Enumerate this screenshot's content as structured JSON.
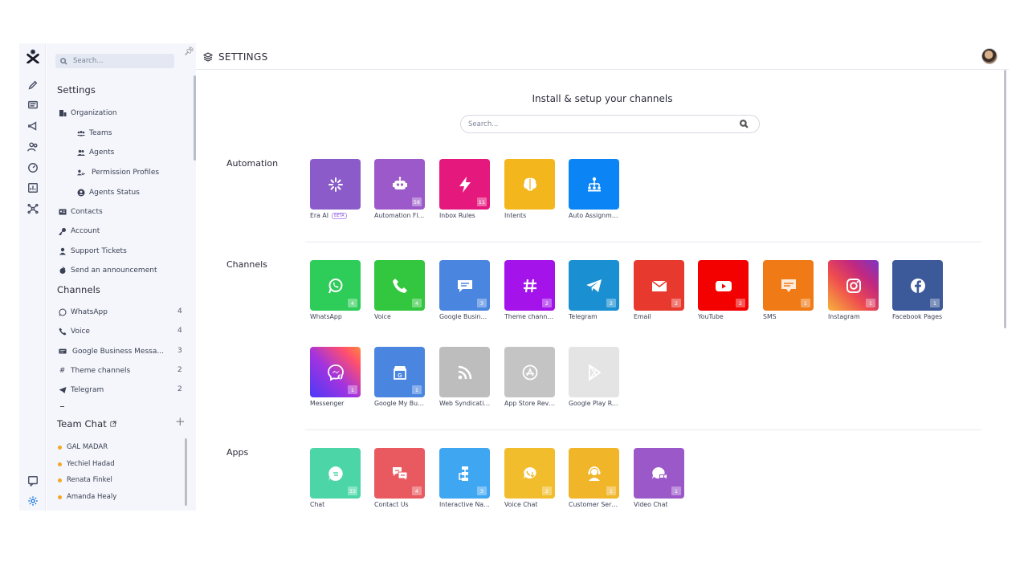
{
  "topbar": {
    "title": "SETTINGS"
  },
  "sidebar": {
    "search_placeholder": "Search...",
    "settings_heading": "Settings",
    "settings_items": [
      {
        "label": "Organization",
        "icon": "building-icon"
      },
      {
        "label": "Teams",
        "icon": "teams-icon"
      },
      {
        "label": "Agents",
        "icon": "agents-icon"
      },
      {
        "label": "Permission Profiles",
        "icon": "permission-icon"
      },
      {
        "label": "Agents Status",
        "icon": "agent-status-icon"
      },
      {
        "label": "Contacts",
        "icon": "contacts-icon"
      },
      {
        "label": "Account",
        "icon": "key-icon"
      },
      {
        "label": "Support Tickets",
        "icon": "user-icon"
      },
      {
        "label": "Send an announcement",
        "icon": "announcement-icon"
      }
    ],
    "channels_heading": "Channels",
    "channels": [
      {
        "label": "WhatsApp",
        "count": "4"
      },
      {
        "label": "Voice",
        "count": "4"
      },
      {
        "label": "Google Business Messa...",
        "count": "3"
      },
      {
        "label": "Theme channels",
        "count": "2"
      },
      {
        "label": "Telegram",
        "count": "2"
      }
    ],
    "team_chat_heading": "Team Chat",
    "team_members": [
      "GAL MADAR",
      "Yechiel Hadad",
      "Renata Finkel",
      "Amanda Healy"
    ]
  },
  "main": {
    "heading": "Install & setup your channels",
    "search_placeholder": "Search...",
    "sections": {
      "automation": "Automation",
      "channels": "Channels",
      "apps": "Apps"
    },
    "automation_tiles": [
      {
        "label": "Era AI",
        "badge": "",
        "beta": "BETA",
        "color": "#8b5cc9"
      },
      {
        "label": "Automation Flo...",
        "badge": "58",
        "color": "#9b59c9"
      },
      {
        "label": "Inbox Rules",
        "badge": "11",
        "color": "#e5197d"
      },
      {
        "label": "Intents",
        "badge": "",
        "color": "#f3b71d"
      },
      {
        "label": "Auto Assignme...",
        "badge": "",
        "color": "#0b84f5"
      }
    ],
    "channel_tiles": [
      {
        "label": "WhatsApp",
        "badge": "4",
        "color": "#2ecc58"
      },
      {
        "label": "Voice",
        "badge": "4",
        "color": "#32c73e"
      },
      {
        "label": "Google Busines...",
        "badge": "3",
        "color": "#4a86e0"
      },
      {
        "label": "Theme channels",
        "badge": "2",
        "color": "#a414ea"
      },
      {
        "label": "Telegram",
        "badge": "2",
        "color": "#1a8fd1"
      },
      {
        "label": "Email",
        "badge": "2",
        "color": "#e8392f"
      },
      {
        "label": "YouTube",
        "badge": "2",
        "color": "#f30000"
      },
      {
        "label": "SMS",
        "badge": "1",
        "color": "#f07a16"
      },
      {
        "label": "Instagram",
        "badge": "1",
        "color": "#d6267a"
      },
      {
        "label": "Facebook Pages",
        "badge": "1",
        "color": "#3c5a9a"
      },
      {
        "label": "Messenger",
        "badge": "1",
        "color": "#7a3cf0"
      },
      {
        "label": "Google My Busi...",
        "badge": "1",
        "color": "#4a86e0"
      },
      {
        "label": "Web Syndicatio...",
        "badge": "",
        "color": "#bdbdbd"
      },
      {
        "label": "App Store Revie...",
        "badge": "",
        "color": "#c4c4c4"
      },
      {
        "label": "Google Play Re...",
        "badge": "",
        "color": "#e4e4e4"
      }
    ],
    "app_tiles": [
      {
        "label": "Chat",
        "badge": "33",
        "color": "#4cd6a8"
      },
      {
        "label": "Contact Us",
        "badge": "4",
        "color": "#e85a5f"
      },
      {
        "label": "Interactive Navi...",
        "badge": "3",
        "color": "#3fa6f2"
      },
      {
        "label": "Voice Chat",
        "badge": "2",
        "color": "#f1bd2c"
      },
      {
        "label": "Customer Servi...",
        "badge": "1",
        "color": "#f1b52a"
      },
      {
        "label": "Video Chat",
        "badge": "1",
        "color": "#9b58c9"
      }
    ]
  }
}
